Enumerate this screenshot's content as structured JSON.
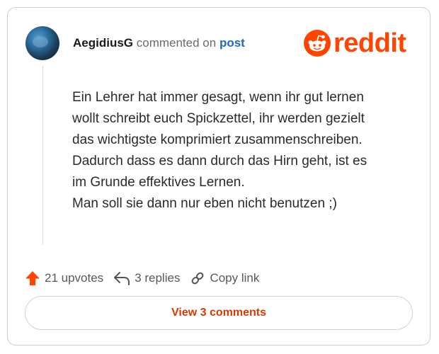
{
  "comment": {
    "username": "AegidiusG",
    "action_text": "commented on",
    "target_link": "post",
    "body_lines": [
      "Ein Lehrer hat immer gesagt, wenn ihr gut lernen",
      "wollt schreibt euch Spickzettel, ihr werden gezielt",
      "das wichtigste komprimiert zusammenschreiben.",
      "Dadurch dass es dann durch das Hirn geht, ist es",
      "im Grunde effektives Lernen.",
      "Man soll sie dann nur eben nicht benutzen ;)"
    ]
  },
  "brand": {
    "name": "reddit",
    "color": "#ff4500",
    "icon": "reddit-snoo-icon"
  },
  "actions": {
    "upvotes_label": "21 upvotes",
    "replies_label": "3 replies",
    "copy_link_label": "Copy link"
  },
  "view_comments_label": "View 3 comments",
  "colors": {
    "accent_orange": "#ff4500",
    "link_blue": "#1f66c7",
    "button_text": "#d93a00"
  }
}
